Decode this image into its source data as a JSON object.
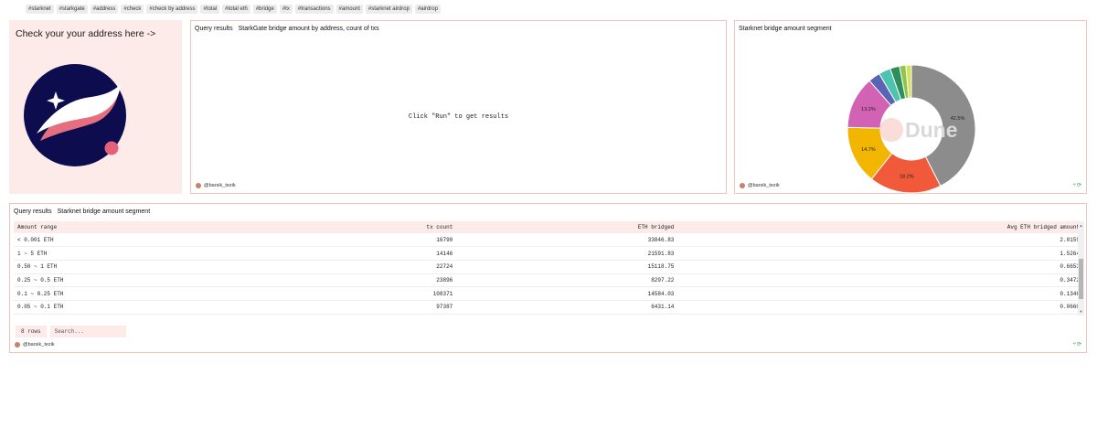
{
  "tags": [
    "#starknet",
    "#starkgate",
    "#address",
    "#check",
    "#check by address",
    "#total",
    "#total eth",
    "#bridge",
    "#tx",
    "#transactions",
    "#amount",
    "#starknet airdrop",
    "#airdrop"
  ],
  "text_panel": {
    "heading": "Check your your address here ->"
  },
  "query_panel": {
    "label": "Query results",
    "title": "StarkGate bridge amount by address, count of txs",
    "run_message": "Click \"Run\" to get results",
    "author": "@barsik_tezik"
  },
  "chart_panel": {
    "title": "Starknet bridge amount segment",
    "watermark": "Dune",
    "author": "@barsik_tezik",
    "chart_data": {
      "type": "pie",
      "slices": [
        {
          "label": "42.5%",
          "value": 42.5,
          "color": "#8c8c8c"
        },
        {
          "label": "18.2%",
          "value": 18.2,
          "color": "#f05a3a"
        },
        {
          "label": "14.7%",
          "value": 14.7,
          "color": "#f2b500"
        },
        {
          "label": "13.2%",
          "value": 13.2,
          "color": "#d162b4"
        },
        {
          "label": "",
          "value": 3.0,
          "color": "#5a63b4"
        },
        {
          "label": "",
          "value": 3.0,
          "color": "#4ec3b0"
        },
        {
          "label": "",
          "value": 2.4,
          "color": "#2f8f5a"
        },
        {
          "label": "",
          "value": 1.6,
          "color": "#8dc64a"
        },
        {
          "label": "",
          "value": 1.4,
          "color": "#d8e060"
        }
      ]
    }
  },
  "table_panel": {
    "label": "Query results",
    "title": "Starknet bridge amount segment",
    "columns": [
      "Amount range",
      "tx count",
      "ETH bridged",
      "Avg ETH bridged amount"
    ],
    "rows": [
      [
        "< 0.001 ETH",
        "16790",
        "33846.83",
        "2.0159"
      ],
      [
        "1 ~ 5 ETH",
        "14146",
        "21591.83",
        "1.5264"
      ],
      [
        "0.50 ~ 1 ETH",
        "22724",
        "15118.75",
        "0.6653"
      ],
      [
        "0.25 ~ 0.5 ETH",
        "23896",
        "8297.22",
        "0.3472"
      ],
      [
        "0.1 ~ 0.25 ETH",
        "108371",
        "14584.03",
        "0.1346"
      ],
      [
        "0.05 ~ 0.1 ETH",
        "97387",
        "6431.14",
        "0.0660"
      ]
    ],
    "row_count": "8 rows",
    "search_placeholder": "Search...",
    "author": "@barsik_tezik"
  },
  "colors": {
    "accent_border": "#f4c2bd",
    "panel_tint": "#fdebea",
    "logo_bg": "#0c0c4f"
  }
}
